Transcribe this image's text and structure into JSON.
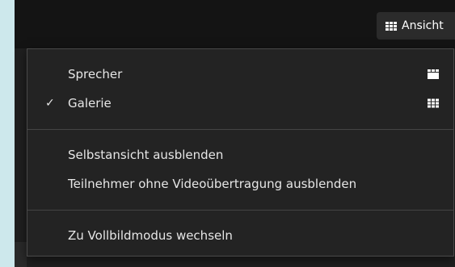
{
  "toolbar": {
    "view_button_label": "Ansicht"
  },
  "view_menu": {
    "layout_items": [
      {
        "label": "Sprecher",
        "checked": false,
        "icon": "speaker-layout-icon"
      },
      {
        "label": "Galerie",
        "checked": true,
        "icon": "gallery-grid-icon"
      }
    ],
    "visibility_items": [
      {
        "label": "Selbstansicht ausblenden"
      },
      {
        "label": "Teilnehmer ohne Videoübertragung ausblenden"
      }
    ],
    "fullscreen_items": [
      {
        "label": "Zu Vollbildmodus wechseln"
      }
    ],
    "check_mark": "✓"
  },
  "colors": {
    "menu_background": "#232323",
    "menu_text": "#e6e6e6",
    "divider": "#444444",
    "outer_background": "#cde8ec"
  }
}
